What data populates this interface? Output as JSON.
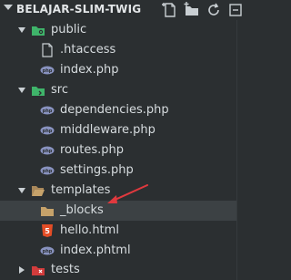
{
  "explorer": {
    "title": "BELAJAR-SLIM-TWIG",
    "toolbar": [
      "new-file-icon",
      "new-folder-icon",
      "refresh-icon",
      "collapse-icon"
    ]
  },
  "tree": [
    {
      "label": "public",
      "type": "folder-green",
      "expanded": true
    },
    {
      "label": ".htaccess",
      "type": "file"
    },
    {
      "label": "index.php",
      "type": "php"
    },
    {
      "label": "src",
      "type": "folder-green",
      "expanded": true
    },
    {
      "label": "dependencies.php",
      "type": "php"
    },
    {
      "label": "middleware.php",
      "type": "php"
    },
    {
      "label": "routes.php",
      "type": "php"
    },
    {
      "label": "settings.php",
      "type": "php"
    },
    {
      "label": "templates",
      "type": "folder",
      "expanded": true
    },
    {
      "label": "_blocks",
      "type": "folder",
      "selected": true
    },
    {
      "label": "hello.html",
      "type": "html"
    },
    {
      "label": "index.phtml",
      "type": "php"
    },
    {
      "label": "tests",
      "type": "folder-red",
      "expanded": false
    }
  ],
  "colors": {
    "bg": "#2b2f31",
    "selected": "#3c4144",
    "php": "#8892bf",
    "html": "#e44d26",
    "folder_green": "#3fb46a",
    "folder": "#c6a26a",
    "arrow": "#e0393e"
  }
}
